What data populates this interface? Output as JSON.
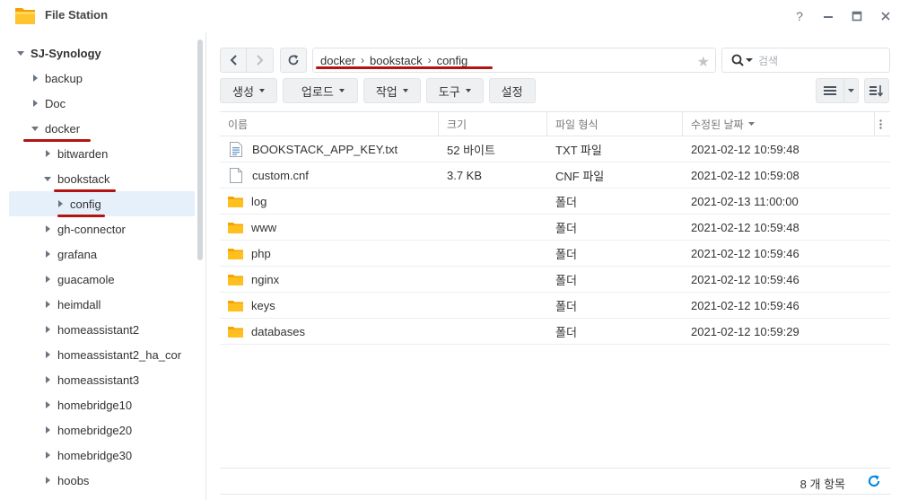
{
  "window": {
    "title": "File Station",
    "controls": {
      "help": "?",
      "minimize": "—",
      "maximize": "▢",
      "close": "✕"
    }
  },
  "sidebar": {
    "root": "SJ-Synology",
    "items": [
      {
        "label": "backup",
        "level": 1,
        "expanded": false
      },
      {
        "label": "Doc",
        "level": 1,
        "expanded": false
      },
      {
        "label": "docker",
        "level": 1,
        "expanded": true
      },
      {
        "label": "bitwarden",
        "level": 2,
        "expanded": false
      },
      {
        "label": "bookstack",
        "level": 2,
        "expanded": true
      },
      {
        "label": "config",
        "level": 3,
        "expanded": false,
        "selected": true
      },
      {
        "label": "gh-connector",
        "level": 2,
        "expanded": false
      },
      {
        "label": "grafana",
        "level": 2,
        "expanded": false
      },
      {
        "label": "guacamole",
        "level": 2,
        "expanded": false
      },
      {
        "label": "heimdall",
        "level": 2,
        "expanded": false
      },
      {
        "label": "homeassistant2",
        "level": 2,
        "expanded": false
      },
      {
        "label": "homeassistant2_ha_cor",
        "level": 2,
        "expanded": false
      },
      {
        "label": "homeassistant3",
        "level": 2,
        "expanded": false
      },
      {
        "label": "homebridge10",
        "level": 2,
        "expanded": false
      },
      {
        "label": "homebridge20",
        "level": 2,
        "expanded": false
      },
      {
        "label": "homebridge30",
        "level": 2,
        "expanded": false
      },
      {
        "label": "hoobs",
        "level": 2,
        "expanded": false
      }
    ]
  },
  "toolbar": {
    "path": [
      "docker",
      "bookstack",
      "config"
    ],
    "path_separator": "›",
    "search_placeholder": "검색",
    "actions": [
      {
        "label": "생성",
        "has_menu": true
      },
      {
        "label": "업로드",
        "has_menu": true
      },
      {
        "label": "작업",
        "has_menu": true
      },
      {
        "label": "도구",
        "has_menu": true
      },
      {
        "label": "설정",
        "has_menu": false
      }
    ]
  },
  "table": {
    "columns": [
      "이름",
      "크기",
      "파일 형식",
      "수정된 날짜"
    ],
    "sort_column": "수정된 날짜",
    "rows": [
      {
        "name": "BOOKSTACK_APP_KEY.txt",
        "size": "52 바이트",
        "type": "TXT 파일",
        "modified": "2021-02-12 10:59:48",
        "icon": "text-file-icon"
      },
      {
        "name": "custom.cnf",
        "size": "3.7 KB",
        "type": "CNF 파일",
        "modified": "2021-02-12 10:59:08",
        "icon": "file-icon"
      },
      {
        "name": "log",
        "size": "",
        "type": "폴더",
        "modified": "2021-02-13 11:00:00",
        "icon": "folder-icon"
      },
      {
        "name": "www",
        "size": "",
        "type": "폴더",
        "modified": "2021-02-12 10:59:48",
        "icon": "folder-icon"
      },
      {
        "name": "php",
        "size": "",
        "type": "폴더",
        "modified": "2021-02-12 10:59:46",
        "icon": "folder-icon"
      },
      {
        "name": "nginx",
        "size": "",
        "type": "폴더",
        "modified": "2021-02-12 10:59:46",
        "icon": "folder-icon"
      },
      {
        "name": "keys",
        "size": "",
        "type": "폴더",
        "modified": "2021-02-12 10:59:46",
        "icon": "folder-icon"
      },
      {
        "name": "databases",
        "size": "",
        "type": "폴더",
        "modified": "2021-02-12 10:59:29",
        "icon": "folder-icon"
      }
    ]
  },
  "status": {
    "item_count": "8 개 항목"
  },
  "colors": {
    "accent": "#0086e5",
    "folder": "#ffb300",
    "selection": "#e6f0fa",
    "annotation_red": "#b31412"
  }
}
